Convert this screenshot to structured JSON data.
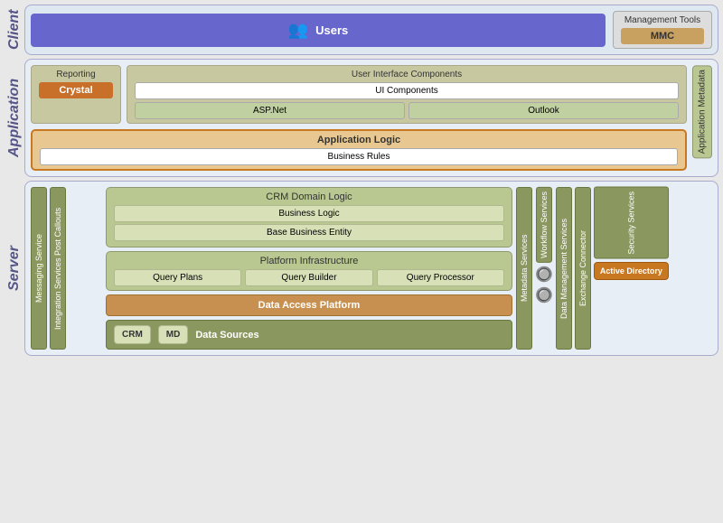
{
  "client": {
    "label": "Client",
    "users": {
      "label": "Users",
      "icon": "👥"
    },
    "management_tools": {
      "label": "Management Tools",
      "mmc": "MMC"
    }
  },
  "application": {
    "label": "Application",
    "reporting": {
      "label": "Reporting",
      "crystal": "Crystal"
    },
    "ui_components": {
      "title": "User Interface Components",
      "ui_comp": "UI Components",
      "asp_net": "ASP.Net",
      "outlook": "Outlook"
    },
    "app_logic": {
      "title": "Application Logic",
      "business_rules": "Business Rules"
    },
    "metadata": "Application Metadata"
  },
  "server": {
    "label": "Server",
    "messaging_service": "Messaging Service",
    "integration_services": "Integration Services Post Callouts",
    "crm_domain": {
      "title": "CRM Domain Logic",
      "business_logic": "Business Logic",
      "base_business_entity": "Base Business Entity"
    },
    "platform": {
      "title": "Platform Infrastructure",
      "query_plans": "Query Plans",
      "query_builder": "Query Builder",
      "query_processor": "Query Processor"
    },
    "metadata_services": "Metadata Services",
    "workflow_services": "Workflow Services",
    "data_management_services": "Data Management Services",
    "exchange_connector": "Exchange Connector",
    "security_services": "Security Services",
    "data_access": "Data Access Platform",
    "data_sources": {
      "label": "Data Sources",
      "crm": "CRM",
      "md": "MD"
    },
    "active_directory": "Active Directory"
  }
}
